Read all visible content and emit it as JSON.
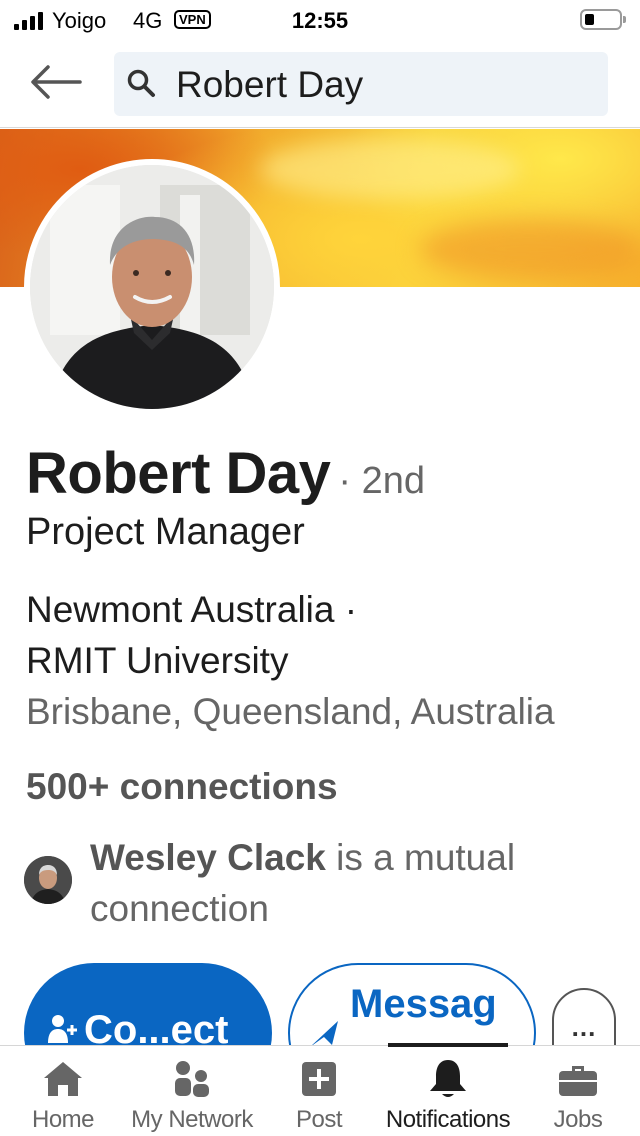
{
  "status_bar": {
    "carrier": "Yoigo",
    "network": "4G",
    "vpn": "VPN",
    "time": "12:55",
    "signal_bars": 4,
    "battery_level": 0.2
  },
  "search": {
    "query": "Robert Day"
  },
  "profile": {
    "name": "Robert Day",
    "degree": "· 2nd",
    "headline": "Project Manager",
    "company": "Newmont Australia ·",
    "school": "RMIT University",
    "location": "Brisbane, Queensland, Australia",
    "connections": "500+ connections",
    "mutual_name": "Wesley Clack",
    "mutual_suffix": " is a mutual connection"
  },
  "actions": {
    "connect_label": "Co...ect",
    "message_label": "Messag",
    "more_label": "..."
  },
  "tabs": [
    {
      "label": "Home",
      "icon": "home-icon",
      "active": false
    },
    {
      "label": "My Network",
      "icon": "my-network-icon",
      "active": false
    },
    {
      "label": "Post",
      "icon": "post-icon",
      "active": false
    },
    {
      "label": "Notifications",
      "icon": "bell-icon",
      "active": true
    },
    {
      "label": "Jobs",
      "icon": "briefcase-icon",
      "active": false
    }
  ],
  "colors": {
    "primary": "#0a66c2",
    "cover_orange": "#f0a42a",
    "cover_yellow": "#f7cf3d",
    "secondary_text": "#666666"
  }
}
